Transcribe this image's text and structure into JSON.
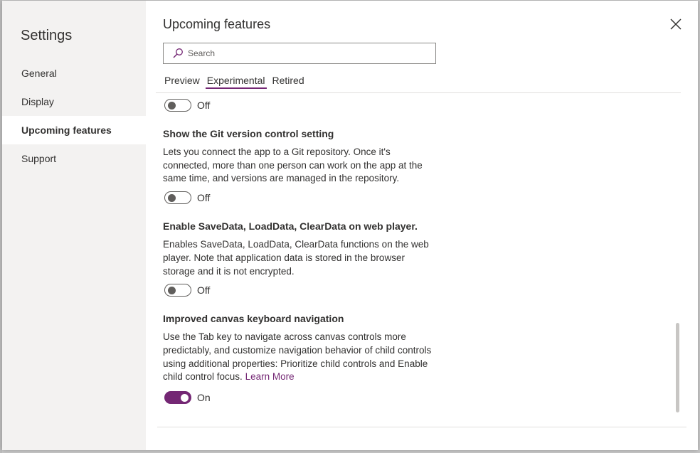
{
  "sidebar": {
    "title": "Settings",
    "items": [
      {
        "label": "General"
      },
      {
        "label": "Display"
      },
      {
        "label": "Upcoming features"
      },
      {
        "label": "Support"
      }
    ]
  },
  "main": {
    "title": "Upcoming features",
    "search": {
      "placeholder": "Search",
      "value": ""
    },
    "tabs": [
      {
        "label": "Preview"
      },
      {
        "label": "Experimental"
      },
      {
        "label": "Retired"
      }
    ],
    "first_toggle": {
      "state_label": "Off"
    },
    "features": [
      {
        "title": "Show the Git version control setting",
        "description": "Lets you connect the app to a Git repository. Once it's connected, more than one person can work on the app at the same time, and versions are managed in the repository.",
        "state_label": "Off",
        "on": false
      },
      {
        "title": "Enable SaveData, LoadData, ClearData on web player.",
        "description": "Enables SaveData, LoadData, ClearData functions on the web player. Note that application data is stored in the browser storage and it is not encrypted.",
        "state_label": "Off",
        "on": false
      },
      {
        "title": "Improved canvas keyboard navigation",
        "description": "Use the Tab key to navigate across canvas controls more predictably, and customize navigation behavior of child controls using additional properties: Prioritize child controls and Enable child control focus.",
        "link_label": "Learn More",
        "state_label": "On",
        "on": true
      }
    ]
  },
  "colors": {
    "accent": "#742774",
    "sidebar_bg": "#f3f2f1",
    "text": "#323130"
  },
  "icons": {
    "close": "close-icon",
    "search": "search-icon"
  }
}
